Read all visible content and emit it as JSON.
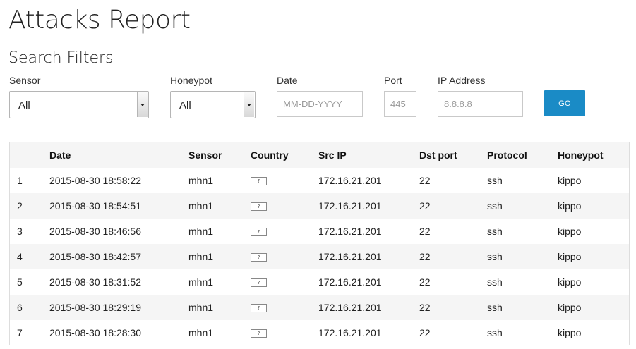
{
  "page": {
    "title": "Attacks Report",
    "filters_title": "Search Filters"
  },
  "filters": {
    "sensor": {
      "label": "Sensor",
      "value": "All"
    },
    "honeypot": {
      "label": "Honeypot",
      "value": "All"
    },
    "date": {
      "label": "Date",
      "placeholder": "MM-DD-YYYY",
      "value": ""
    },
    "port": {
      "label": "Port",
      "placeholder": "445",
      "value": ""
    },
    "ip": {
      "label": "IP Address",
      "placeholder": "8.8.8.8",
      "value": ""
    },
    "go_label": "GO"
  },
  "colors": {
    "accent": "#1a8bc6",
    "row_stripe": "#f5f5f5",
    "border": "#dddddd"
  },
  "table": {
    "headers": [
      "",
      "Date",
      "Sensor",
      "Country",
      "Src IP",
      "Dst port",
      "Protocol",
      "Honeypot"
    ],
    "rows": [
      {
        "num": "1",
        "date": "2015-08-30 18:58:22",
        "sensor": "mhn1",
        "country_icon": "unknown-flag-icon",
        "country_glyph": "?",
        "src_ip": "172.16.21.201",
        "dst_port": "22",
        "protocol": "ssh",
        "honeypot": "kippo"
      },
      {
        "num": "2",
        "date": "2015-08-30 18:54:51",
        "sensor": "mhn1",
        "country_icon": "unknown-flag-icon",
        "country_glyph": "?",
        "src_ip": "172.16.21.201",
        "dst_port": "22",
        "protocol": "ssh",
        "honeypot": "kippo"
      },
      {
        "num": "3",
        "date": "2015-08-30 18:46:56",
        "sensor": "mhn1",
        "country_icon": "unknown-flag-icon",
        "country_glyph": "?",
        "src_ip": "172.16.21.201",
        "dst_port": "22",
        "protocol": "ssh",
        "honeypot": "kippo"
      },
      {
        "num": "4",
        "date": "2015-08-30 18:42:57",
        "sensor": "mhn1",
        "country_icon": "unknown-flag-icon",
        "country_glyph": "?",
        "src_ip": "172.16.21.201",
        "dst_port": "22",
        "protocol": "ssh",
        "honeypot": "kippo"
      },
      {
        "num": "5",
        "date": "2015-08-30 18:31:52",
        "sensor": "mhn1",
        "country_icon": "unknown-flag-icon",
        "country_glyph": "?",
        "src_ip": "172.16.21.201",
        "dst_port": "22",
        "protocol": "ssh",
        "honeypot": "kippo"
      },
      {
        "num": "6",
        "date": "2015-08-30 18:29:19",
        "sensor": "mhn1",
        "country_icon": "unknown-flag-icon",
        "country_glyph": "?",
        "src_ip": "172.16.21.201",
        "dst_port": "22",
        "protocol": "ssh",
        "honeypot": "kippo"
      },
      {
        "num": "7",
        "date": "2015-08-30 18:28:30",
        "sensor": "mhn1",
        "country_icon": "unknown-flag-icon",
        "country_glyph": "?",
        "src_ip": "172.16.21.201",
        "dst_port": "22",
        "protocol": "ssh",
        "honeypot": "kippo"
      }
    ]
  }
}
